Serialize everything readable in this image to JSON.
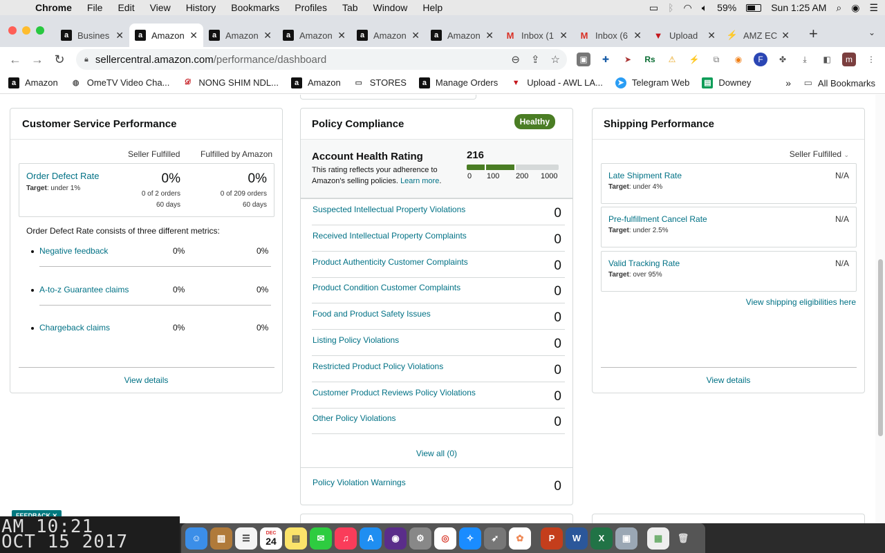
{
  "menubar": {
    "app": "Chrome",
    "items": [
      "File",
      "Edit",
      "View",
      "History",
      "Bookmarks",
      "Profiles",
      "Tab",
      "Window",
      "Help"
    ],
    "battery": "59%",
    "clock": "Sun 1:25 AM"
  },
  "tabs": [
    {
      "title": "Busines",
      "icon": "amazon"
    },
    {
      "title": "Amazon",
      "icon": "amazon"
    },
    {
      "title": "Amazon",
      "icon": "amazon"
    },
    {
      "title": "Amazon",
      "icon": "amazon"
    },
    {
      "title": "Amazon",
      "icon": "amazon"
    },
    {
      "title": "Amazon",
      "icon": "amazon"
    },
    {
      "title": "Inbox (1",
      "icon": "gmail"
    },
    {
      "title": "Inbox (6",
      "icon": "gmail"
    },
    {
      "title": "Upload",
      "icon": "upload"
    },
    {
      "title": "AMZ EC",
      "icon": "amzec"
    }
  ],
  "url": {
    "domain": "sellercentral.amazon.com",
    "path": "/performance/dashboard"
  },
  "profile_initial": "m",
  "bookmarks": [
    "Amazon",
    "OmeTV Video Cha...",
    "NONG SHIM NDL...",
    "Amazon",
    "STORES",
    "Manage Orders",
    "Upload - AWL LA...",
    "Telegram Web",
    "Downey"
  ],
  "bookmarks_all": "All Bookmarks",
  "customer_service": {
    "title": "Customer Service Performance",
    "col_seller": "Seller Fulfilled",
    "col_fba": "Fulfilled by Amazon",
    "odr": {
      "label": "Order Defect Rate",
      "target_label": "Target",
      "target_value": ": under 1%",
      "seller_pct": "0%",
      "seller_orders": "0 of 2 orders",
      "seller_days": "60 days",
      "fba_pct": "0%",
      "fba_orders": "0 of 209 orders",
      "fba_days": "60 days"
    },
    "consists_text": "Order Defect Rate consists of three different metrics:",
    "metrics": [
      {
        "label": "Negative feedback",
        "seller": "0%",
        "fba": "0%"
      },
      {
        "label": "A-to-z Guarantee claims",
        "seller": "0%",
        "fba": "0%"
      },
      {
        "label": "Chargeback claims",
        "seller": "0%",
        "fba": "0%"
      }
    ],
    "view_details": "View details"
  },
  "policy": {
    "title": "Policy Compliance",
    "badge": "Healthy",
    "ahr_title": "Account Health Rating",
    "ahr_desc1": "This rating reflects your adherence to",
    "ahr_desc2": "Amazon's selling policies.",
    "learn_more": "Learn more",
    "score": "216",
    "score_value": 216,
    "scale": [
      "0",
      "100",
      "200",
      "1000"
    ],
    "violations": [
      {
        "label": "Suspected Intellectual Property Violations",
        "count": "0"
      },
      {
        "label": "Received Intellectual Property Complaints",
        "count": "0"
      },
      {
        "label": "Product Authenticity Customer Complaints",
        "count": "0"
      },
      {
        "label": "Product Condition Customer Complaints",
        "count": "0"
      },
      {
        "label": "Food and Product Safety Issues",
        "count": "0"
      },
      {
        "label": "Listing Policy Violations",
        "count": "0"
      },
      {
        "label": "Restricted Product Policy Violations",
        "count": "0"
      },
      {
        "label": "Customer Product Reviews Policy Violations",
        "count": "0"
      },
      {
        "label": "Other Policy Violations",
        "count": "0"
      }
    ],
    "view_all": "View all (0)",
    "warnings_label": "Policy Violation Warnings",
    "warnings_count": "0"
  },
  "shipping": {
    "title": "Shipping Performance",
    "filter": "Seller Fulfilled",
    "metrics": [
      {
        "label": "Late Shipment Rate",
        "target_label": "Target",
        "target_value": ": under 4%",
        "value": "N/A"
      },
      {
        "label": "Pre-fulfillment Cancel Rate",
        "target_label": "Target",
        "target_value": ": under 2.5%",
        "value": "N/A"
      },
      {
        "label": "Valid Tracking Rate",
        "target_label": "Target",
        "target_value": ": over 95%",
        "value": "N/A"
      }
    ],
    "eligibilities_link": "View shipping eligibilities here",
    "view_details": "View details"
  },
  "feedback_label": "FEEDBACK",
  "desktop_clock": {
    "line1": "AM 10:21",
    "line2": "OCT 15 2017"
  },
  "dock_calendar": {
    "month": "DEC",
    "day": "24"
  }
}
